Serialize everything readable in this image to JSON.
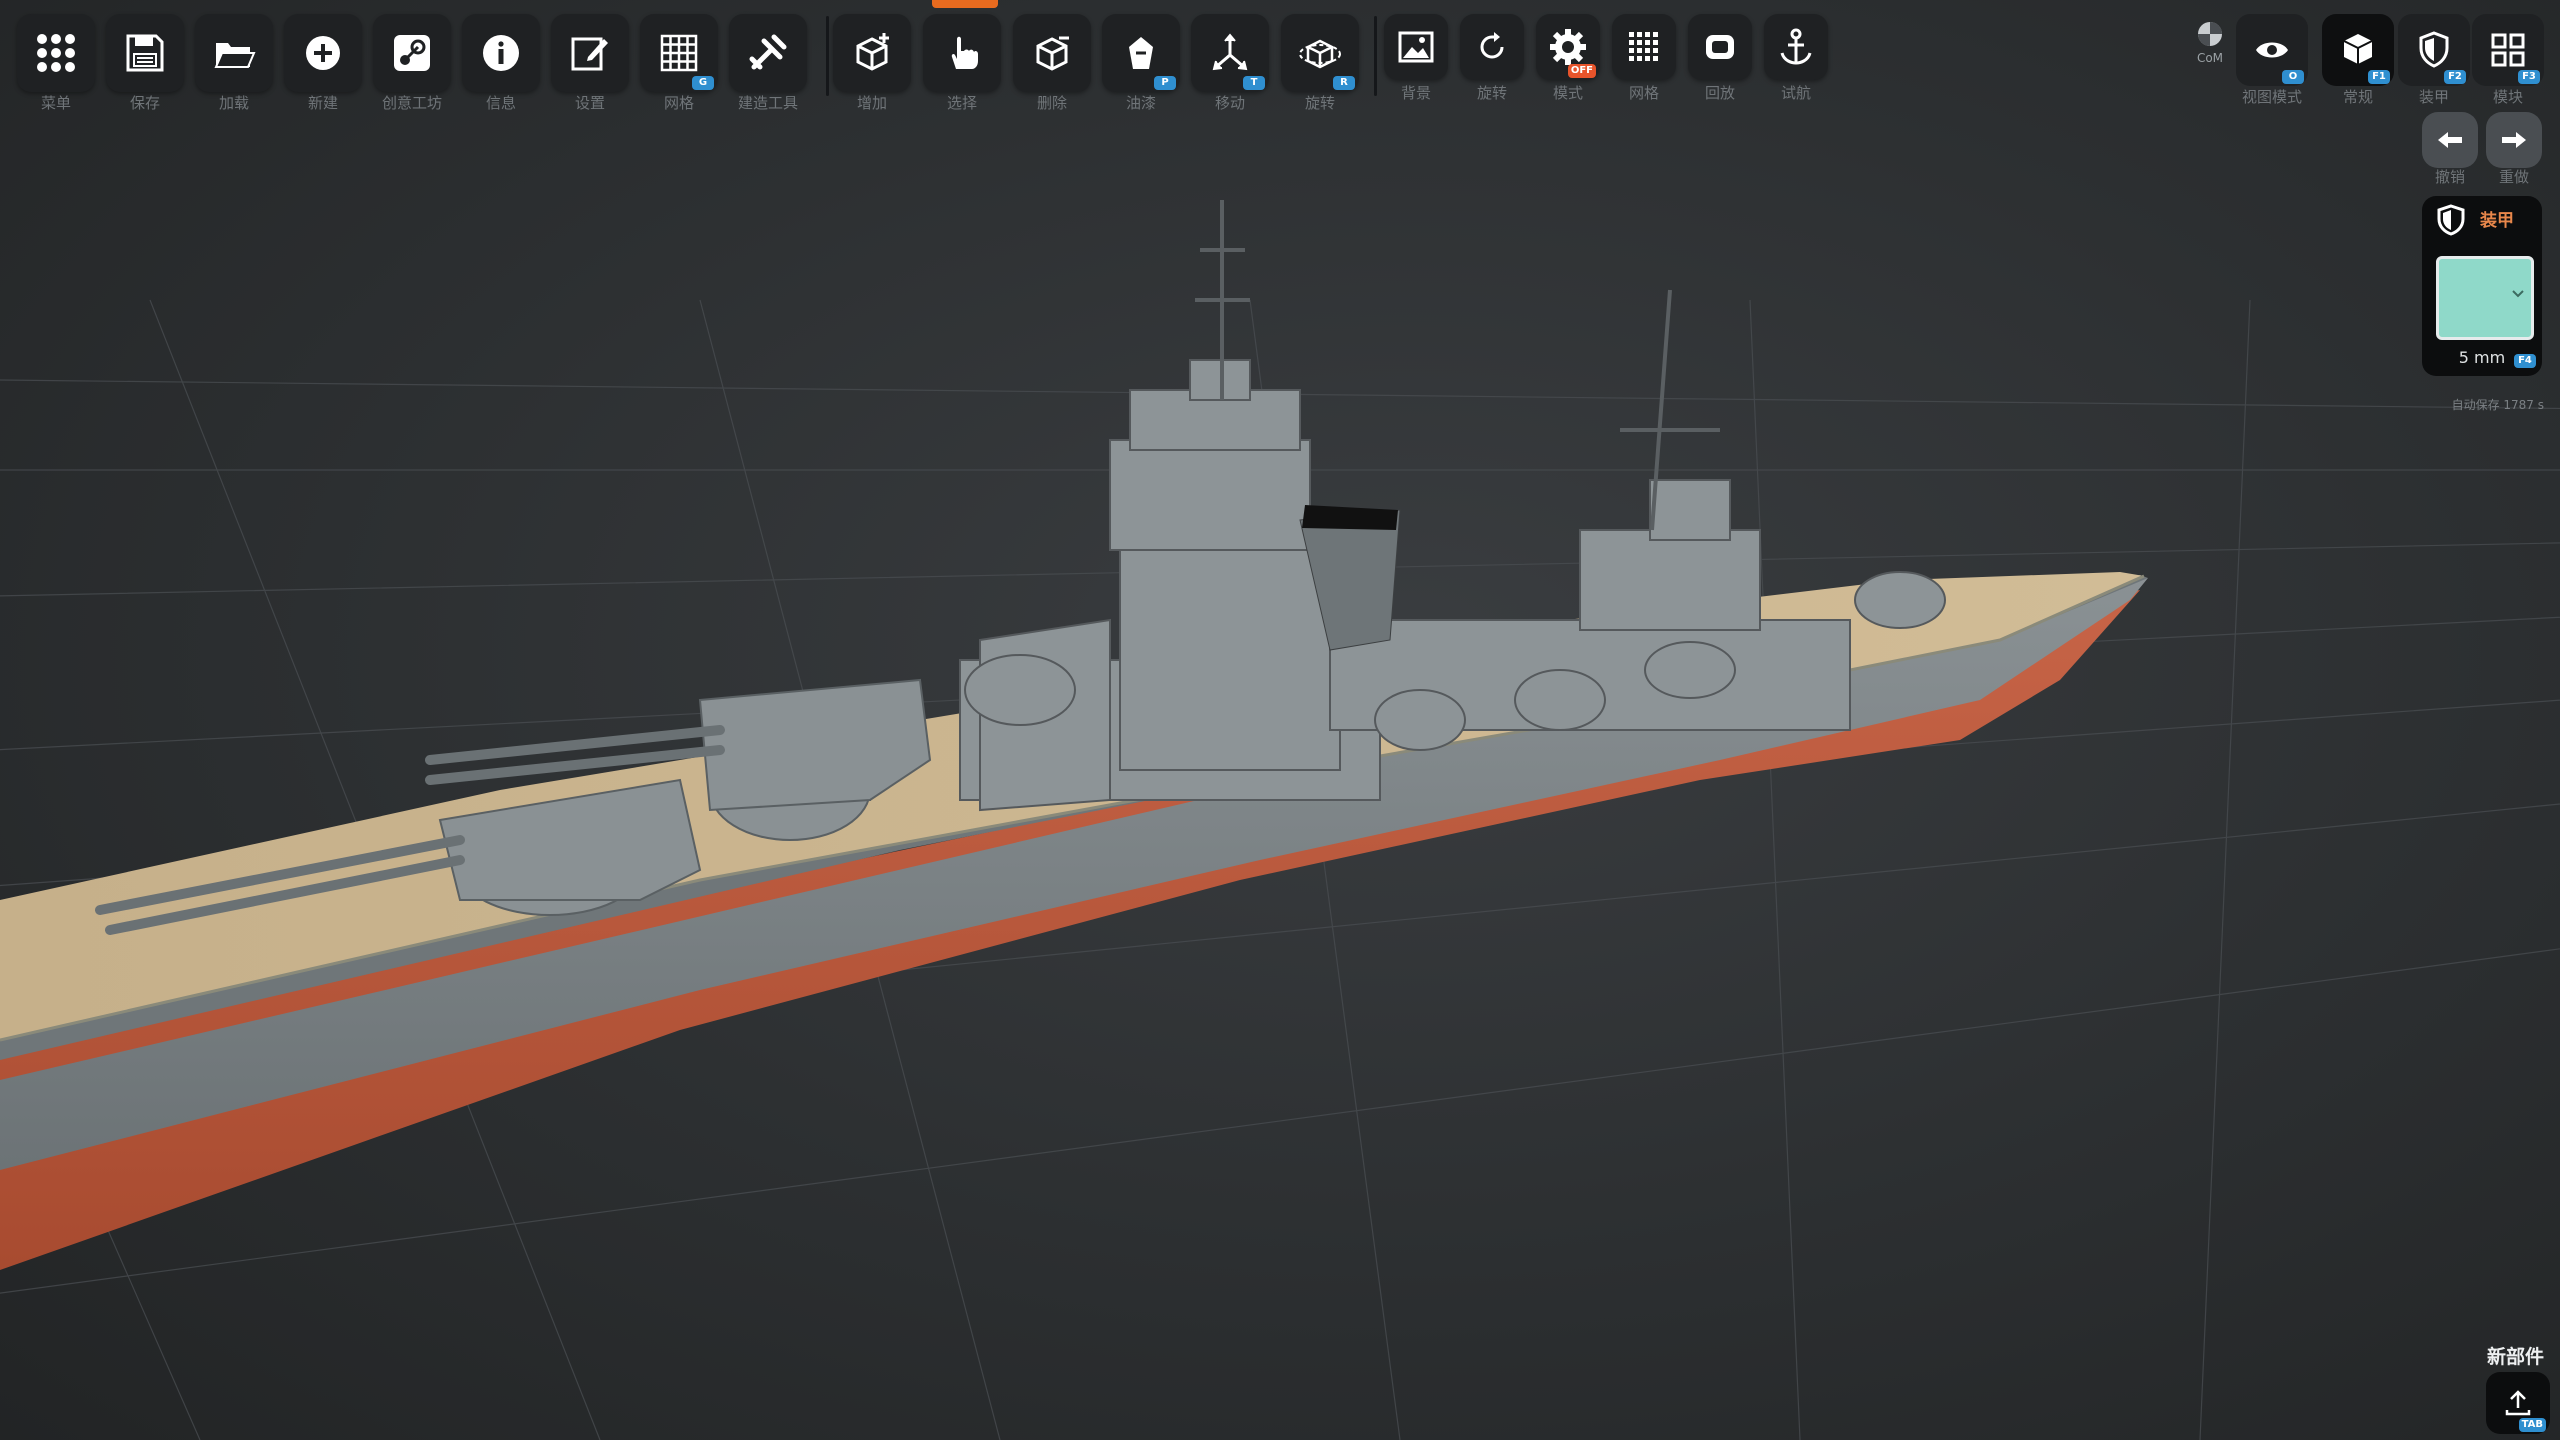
{
  "toolbar": {
    "buttons": [
      {
        "label": "菜单",
        "icon": "grid-dots-icon"
      },
      {
        "label": "保存",
        "icon": "save-icon"
      },
      {
        "label": "加载",
        "icon": "folder-icon"
      },
      {
        "label": "新建",
        "icon": "plus-circle-icon"
      },
      {
        "label": "创意工坊",
        "icon": "steam-icon"
      },
      {
        "label": "信息",
        "icon": "info-icon"
      },
      {
        "label": "设置",
        "icon": "edit-icon"
      },
      {
        "label": "网格",
        "icon": "grid-icon",
        "badge": "G"
      },
      {
        "label": "建造工具",
        "icon": "tools-icon"
      },
      {
        "label": "增加",
        "icon": "add-cube-icon"
      },
      {
        "label": "选择",
        "icon": "hand-pointer-icon"
      },
      {
        "label": "删除",
        "icon": "delete-cube-icon"
      },
      {
        "label": "油漆",
        "icon": "paint-bucket-icon",
        "badge": "P"
      },
      {
        "label": "移动",
        "icon": "move-axes-icon",
        "badge": "T"
      },
      {
        "label": "旋转",
        "icon": "rotate-cube-icon",
        "badge": "R"
      },
      {
        "label": "背景",
        "icon": "image-icon"
      },
      {
        "label": "旋转",
        "icon": "rotate-icon"
      },
      {
        "label": "模式",
        "icon": "gear-icon",
        "badge": "OFF"
      },
      {
        "label": "网格",
        "icon": "small-grid-icon"
      },
      {
        "label": "回放",
        "icon": "replay-icon"
      },
      {
        "label": "试航",
        "icon": "anchor-icon"
      }
    ]
  },
  "right_toolbar": {
    "com_label": "CoM",
    "buttons": [
      {
        "label": "视图模式",
        "icon": "eye-icon",
        "badge": "O"
      },
      {
        "label": "常规",
        "icon": "cube-icon",
        "badge": "F1"
      },
      {
        "label": "装甲",
        "icon": "shield-icon",
        "badge": "F2"
      },
      {
        "label": "模块",
        "icon": "modules-icon",
        "badge": "F3"
      }
    ],
    "undo_label": "撤销",
    "redo_label": "重做"
  },
  "armor_panel": {
    "title": "装甲",
    "color": "#8fd9c9",
    "thickness": "5 mm",
    "badge": "F4"
  },
  "autosave": "自动保存 1787 s",
  "new_part": {
    "label": "新部件",
    "badge": "TAB"
  },
  "colors": {
    "background": "#2c2f31",
    "hull_gray": "#7c8386",
    "deck_tan": "#c8b38c",
    "hull_red": "#b85a3c",
    "accent_blue": "#2f8fd0",
    "accent_orange": "#e86b1f"
  }
}
